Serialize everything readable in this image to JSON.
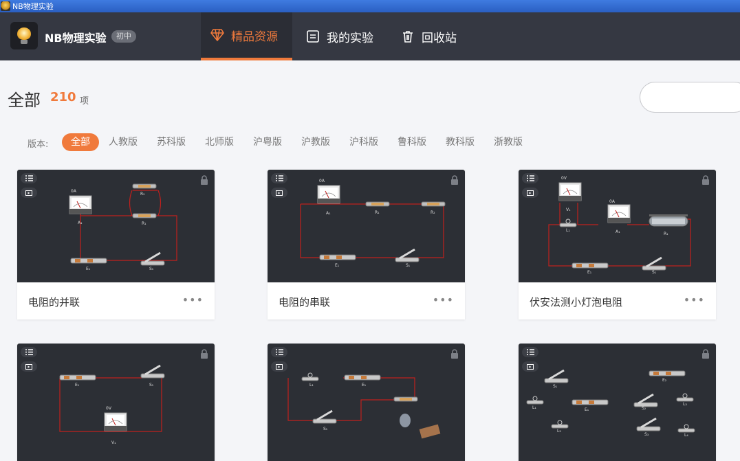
{
  "window": {
    "title": "NB物理实验"
  },
  "app": {
    "name": "NB物理实验",
    "level_badge": "初中"
  },
  "nav": {
    "tabs": [
      {
        "label": "精品资源",
        "icon": "diamond-icon",
        "active": true
      },
      {
        "label": "我的实验",
        "icon": "document-icon",
        "active": false
      },
      {
        "label": "回收站",
        "icon": "trash-icon",
        "active": false
      }
    ]
  },
  "header": {
    "title": "全部",
    "count": "210",
    "unit": "项"
  },
  "search": {
    "placeholder": ""
  },
  "filters": {
    "label": "版本:",
    "items": [
      "全部",
      "人教版",
      "苏科版",
      "北师版",
      "沪粤版",
      "沪教版",
      "沪科版",
      "鲁科版",
      "教科版",
      "浙教版"
    ],
    "active": "全部"
  },
  "cards": [
    {
      "title": "电阻的并联",
      "more": "•••",
      "labels": {
        "meter_a_value": "0A",
        "meter_a": "A₁",
        "r2": "R₂",
        "r1": "R₁",
        "e1": "E₁",
        "s1": "S₁"
      }
    },
    {
      "title": "电阻的串联",
      "more": "•••",
      "labels": {
        "meter_a_value": "0A",
        "meter_a": "A₁",
        "r1": "R₁",
        "r2": "R₂",
        "e1": "E₁",
        "s1": "S₁"
      }
    },
    {
      "title": "伏安法测小灯泡电阻",
      "more": "•••",
      "labels": {
        "meter_v_value": "0V",
        "meter_v": "V₁",
        "l1": "L₁",
        "meter_a_value": "0A",
        "meter_a": "A₁",
        "r1": "R₁",
        "e1": "E₁",
        "s1": "S₁"
      }
    },
    {
      "title": "",
      "more": "",
      "labels": {
        "e1": "E₁",
        "s1": "S₁",
        "meter_v_value": "0V",
        "meter_v": "V₁"
      }
    },
    {
      "title": "",
      "more": "",
      "labels": {
        "l1": "L₁",
        "e1": "E₁",
        "s1": "S₁"
      }
    },
    {
      "title": "",
      "more": "",
      "labels": {
        "s1": "S₁",
        "e2": "E₂",
        "l1": "L₁",
        "e1": "E₁",
        "s2": "S₂",
        "l3": "L₃",
        "l2": "L₂",
        "s3": "S₃",
        "l4": "L₄"
      }
    }
  ],
  "colors": {
    "accent": "#f07a3c",
    "nav_bg": "#353842",
    "thumb_bg": "#2c2f35",
    "wire": "#c0201d"
  }
}
